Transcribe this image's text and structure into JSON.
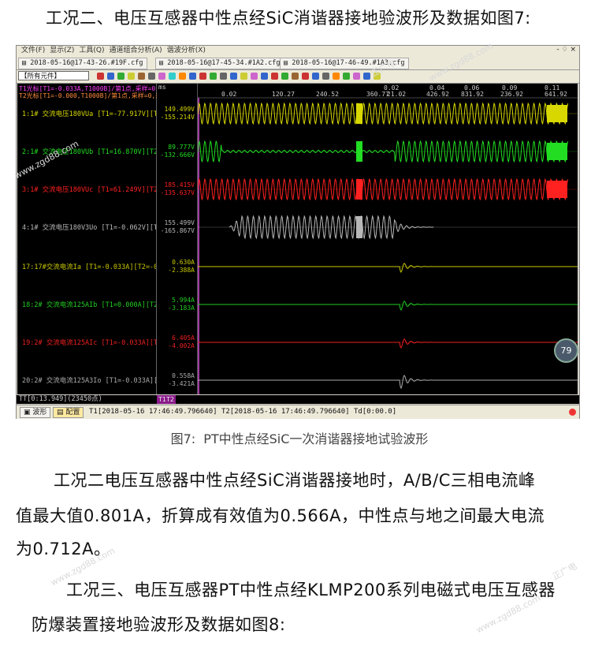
{
  "heading2": "工况二、电压互感器中性点经SiC消谐器接地验波形及数据如图7:",
  "window": {
    "menu": [
      "文件(F)",
      "显示(Z)",
      "工具(Q)",
      "通道组合分析(A)",
      "谐波分析(X)"
    ],
    "menu_right": "- ♢ ×",
    "file_tabs": [
      "2018-05-16@17-43-26.#19F.cfg",
      "2018-05-16@17-45-34.#1A2.cfg",
      "2018-05-16@17-46-49.#1A3.cfg"
    ],
    "element_selector": "【所有元件】",
    "cursor_info": [
      {
        "text": "T1光标[T1=-0.033A,T1000B]/第1点,采样=0,00000",
        "color": "#ff3cff"
      },
      {
        "text": "T2光标[T1=-0.000,T1000B]/第1点,采样=0,采样...",
        "color": "#ff8c3c"
      }
    ],
    "axis_unit": "ms",
    "top_ticks": [
      {
        "label": "0.02",
        "row": 0
      },
      {
        "label": "0.04",
        "row": 0
      },
      {
        "label": "0.06",
        "row": 0
      },
      {
        "label": "0.09",
        "row": 0
      },
      {
        "label": "0.11",
        "row": 0
      },
      {
        "label": "0.02",
        "row": 1
      },
      {
        "label": "120.27",
        "row": 1
      },
      {
        "label": "240.52",
        "row": 1
      },
      {
        "label": "360.77",
        "row": 1
      },
      {
        "label": "21.02",
        "row": 1
      },
      {
        "label": "426.92",
        "row": 1
      },
      {
        "label": "831.92",
        "row": 1
      },
      {
        "label": "236.92",
        "row": 1
      },
      {
        "label": "641.92",
        "row": 1
      }
    ],
    "channels": [
      {
        "label": "1:1# 交流电压180VUa [T1=-77.917V][T2",
        "max": "149.499V",
        "min": "-155.214V",
        "color": "#d8d800",
        "kind": "voltage"
      },
      {
        "label": "2:1# 交流电压180VUb [T1=16.870V][T2",
        "max": "89.777V",
        "min": "-132.666V",
        "color": "#22dd22",
        "kind": "voltage"
      },
      {
        "label": "3:1# 交流电压180VUc [T1=61.249V][T2",
        "max": "185.415V",
        "min": "-135.637V",
        "color": "#ff2020",
        "kind": "voltage"
      },
      {
        "label": "4:1# 交流电压180V3Uo [T1=-0.062V][T2",
        "max": "155.499V",
        "min": "-165.867V",
        "color": "#b8b8b8",
        "kind": "voltage"
      },
      {
        "label": "17:17#交流电流Ia [T1=-0.033A][T2=-0",
        "max": "0.630A",
        "min": "-2.388A",
        "color": "#c8c800",
        "kind": "current"
      },
      {
        "label": "18:2# 交流电流125AIb [T1=0.000A][T2",
        "max": "5.994A",
        "min": "-3.183A",
        "color": "#22cc22",
        "kind": "current"
      },
      {
        "label": "19:2# 交流电流125AIc [T1=-0.033A][T2",
        "max": "6.405A",
        "min": "-4.002A",
        "color": "#ee2020",
        "kind": "current"
      },
      {
        "label": "20:2# 交流电流125A3Io [T1=-0.033A][T",
        "max": "0.558A",
        "min": "-3.421A",
        "color": "#aaaaaa",
        "kind": "current"
      }
    ],
    "status": "TT[0:13.949](23450点)",
    "cursor_label": "T1T2",
    "bottom_tabs": [
      "波形",
      "配置"
    ],
    "time_info": "T1[2018-05-16 17:46:49.796640] T2[2018-05-16 17:46:49.796640] Td[0:00.0]",
    "badge": "79"
  },
  "caption": {
    "fig": "图7:",
    "text": "PT中性点经SiC一次消谐器接地试验波形"
  },
  "body1a": "工况二电压互感器中性点经SiC消谐器接地时，A/B/C三相电流峰",
  "body1b": "值最大值0.801A，折算成有效值为0.566A，中性点与地之间最大电流",
  "body1c": "为0.712A。",
  "heading3a": "工况三、电压互感器PT中性点经KLMP200系列电磁式电压互感器",
  "heading3b": "防爆装置接地验波形及数据如图8:",
  "watermarks": [
    "正广电",
    "www.zgd88.com"
  ]
}
